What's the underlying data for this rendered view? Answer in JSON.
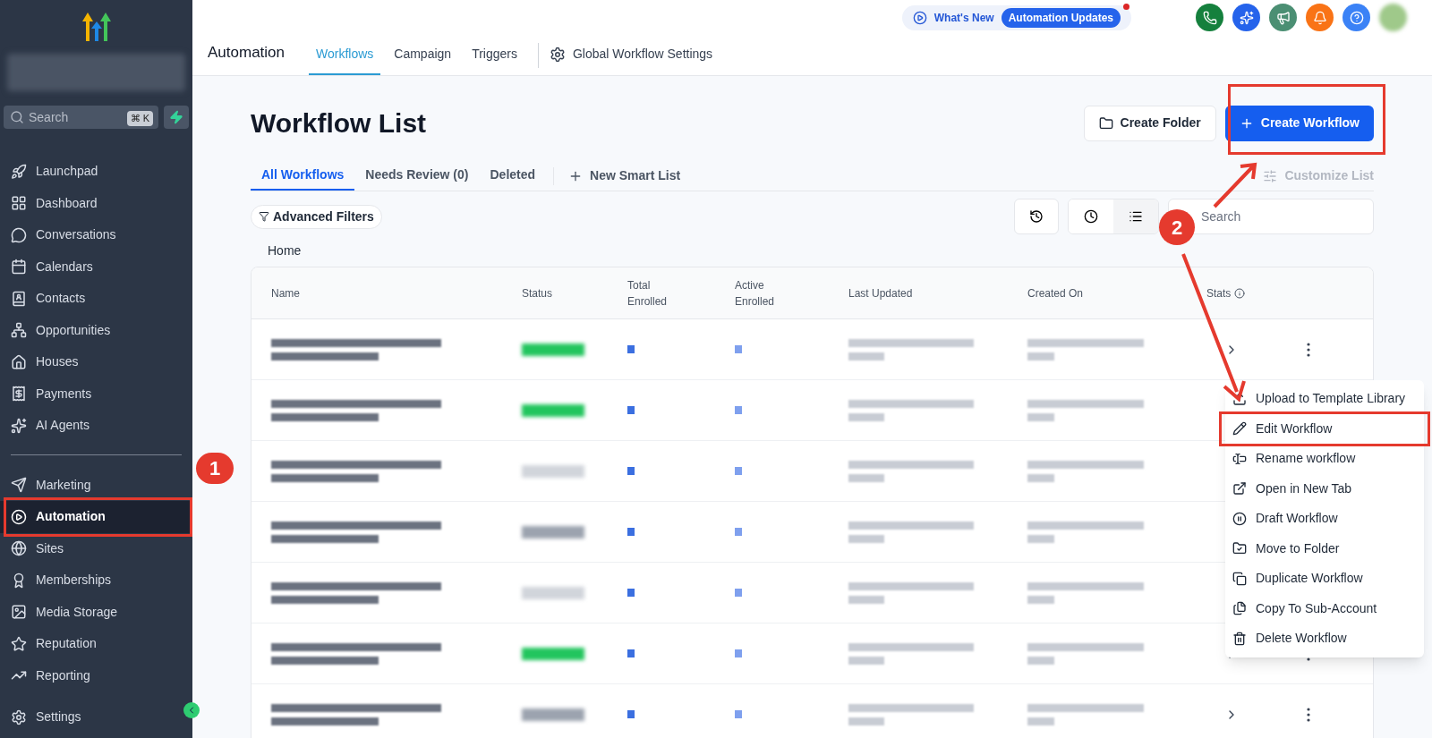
{
  "sidebar": {
    "search": {
      "placeholder": "Search",
      "shortcut": "⌘ K"
    },
    "items": [
      {
        "label": "Launchpad",
        "selected": false
      },
      {
        "label": "Dashboard",
        "selected": false
      },
      {
        "label": "Conversations",
        "selected": false
      },
      {
        "label": "Calendars",
        "selected": false
      },
      {
        "label": "Contacts",
        "selected": false
      },
      {
        "label": "Opportunities",
        "selected": false
      },
      {
        "label": "Houses",
        "selected": false
      },
      {
        "label": "Payments",
        "selected": false
      },
      {
        "label": "AI Agents",
        "selected": false
      }
    ],
    "items_2": [
      {
        "label": "Marketing",
        "selected": false
      },
      {
        "label": "Automation",
        "selected": true
      },
      {
        "label": "Sites",
        "selected": false
      },
      {
        "label": "Memberships",
        "selected": false
      },
      {
        "label": "Media Storage",
        "selected": false
      },
      {
        "label": "Reputation",
        "selected": false
      },
      {
        "label": "Reporting",
        "selected": false
      }
    ],
    "settings": "Settings"
  },
  "top_bar": {
    "whats_new": "What's New",
    "badge": "Automation Updates"
  },
  "header": {
    "title": "Automation",
    "tabs": [
      {
        "label": "Workflows",
        "selected": true
      },
      {
        "label": "Campaign",
        "selected": false
      },
      {
        "label": "Triggers",
        "selected": false
      }
    ],
    "settings_link": "Global Workflow Settings"
  },
  "page": {
    "title": "Workflow List",
    "create_folder": "Create Folder",
    "create_workflow": "Create Workflow",
    "tabs": [
      {
        "label": "All Workflows",
        "selected": true
      },
      {
        "label": "Needs Review (0)",
        "selected": false
      },
      {
        "label": "Deleted",
        "selected": false
      }
    ],
    "view_modes": [
      {
        "selected": false
      },
      {
        "selected": true
      }
    ],
    "new_smart_list": "New Smart List",
    "customize_list": "Customize List",
    "advanced_filters": "Advanced Filters",
    "search": {
      "placeholder": "Search"
    },
    "breadcrumb": "Home"
  },
  "table": {
    "columns": [
      "Name",
      "Status",
      "Total\nEnrolled",
      "Active\nEnrolled",
      "Last Updated",
      "Created On",
      "Stats"
    ],
    "rows": [
      {
        "color": "#22c55e"
      },
      {
        "color": "#22c55e"
      },
      {
        "color": "#d1d5db"
      },
      {
        "color": "#9ca3af"
      },
      {
        "color": "#d1d5db"
      },
      {
        "color": "#22c55e"
      },
      {
        "color": "#9ca3af"
      }
    ]
  },
  "menu": [
    {
      "label": "Upload to Template Library",
      "selected": false
    },
    {
      "label": "Edit Workflow",
      "selected": true
    },
    {
      "label": "Rename workflow",
      "selected": false
    },
    {
      "label": "Open in New Tab",
      "selected": false
    },
    {
      "label": "Draft Workflow",
      "selected": false
    },
    {
      "label": "Move to Folder",
      "selected": false
    },
    {
      "label": "Duplicate Workflow",
      "selected": false
    },
    {
      "label": "Copy To Sub-Account",
      "selected": false
    },
    {
      "label": "Delete Workflow",
      "selected": false
    }
  ],
  "annotations": [
    "1",
    "2"
  ]
}
